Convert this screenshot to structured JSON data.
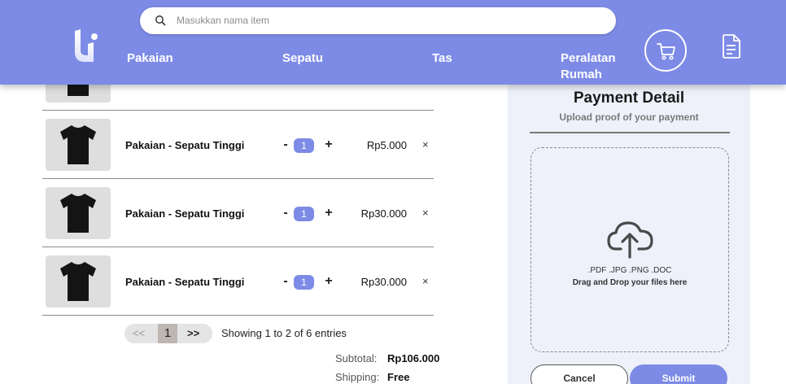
{
  "colors": {
    "brand": "#7d8be6",
    "panel": "#eef1fa",
    "thumb_bg": "#dedede"
  },
  "header": {
    "search_placeholder": "Masukkan nama item",
    "nav": [
      "Pakaian",
      "Sepatu",
      "Tas",
      "Peralatan Rumah"
    ],
    "icons": {
      "search": "search-icon",
      "cart": "cart-icon",
      "document": "document-icon",
      "logo": "logo-icon"
    }
  },
  "cart": {
    "items": [
      {
        "name": "Pakaian - Sepatu Tinggi",
        "qty": "1",
        "price": "Rp5.000"
      },
      {
        "name": "Pakaian - Sepatu Tinggi",
        "qty": "1",
        "price": "Rp30.000"
      },
      {
        "name": "Pakaian - Sepatu Tinggi",
        "qty": "1",
        "price": "Rp30.000"
      }
    ],
    "minus": "-",
    "plus": "+",
    "remove": "×"
  },
  "pagination": {
    "prev": "<<",
    "current": "1",
    "next": ">>",
    "entries": "Showing 1 to 2 of 6 entries"
  },
  "summary": {
    "subtotal_label": "Subtotal:",
    "subtotal_value": "Rp106.000",
    "shipping_label": "Shipping:",
    "shipping_value": "Free"
  },
  "payment": {
    "title": "Payment Detail",
    "subtitle": "Upload proof of your payment",
    "file_types": ".PDF .JPG .PNG .DOC",
    "drop_hint": "Drag and Drop your files here",
    "cancel": "Cancel",
    "submit": "Submit"
  }
}
